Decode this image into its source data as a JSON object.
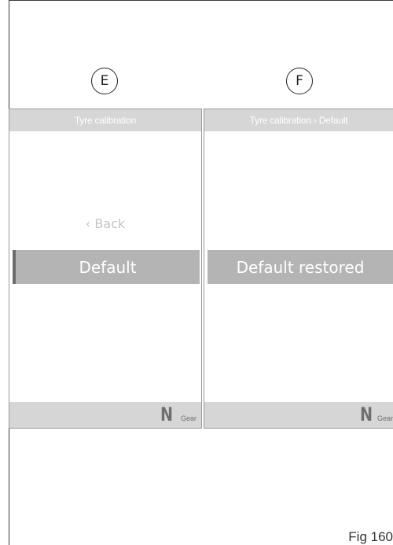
{
  "figure_label": "Fig 160",
  "panels": [
    {
      "letter": "E",
      "header_title": "Tyre calibration",
      "back_label": "‹ Back",
      "selected_item": "Default",
      "gear_letter": "N",
      "gear_label": "Gear"
    },
    {
      "letter": "F",
      "header_title": "Tyre calibration › Default",
      "selected_item": "Default restored",
      "gear_letter": "N",
      "gear_label": "Gear"
    }
  ]
}
